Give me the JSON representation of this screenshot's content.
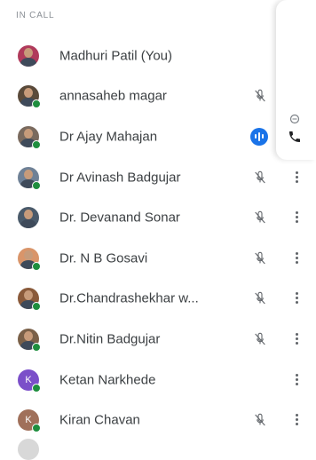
{
  "section": {
    "header": "IN CALL"
  },
  "participants": [
    {
      "name": "Madhuri Patil (You)",
      "avatar": {
        "type": "photo",
        "bg": "#b03a5b",
        "presence": false
      },
      "mic": "none",
      "more": false
    },
    {
      "name": "annasaheb magar",
      "avatar": {
        "type": "photo",
        "bg": "#5a4a3a",
        "presence": true
      },
      "mic": "muted",
      "more": false
    },
    {
      "name": "Dr Ajay Mahajan",
      "avatar": {
        "type": "photo",
        "bg": "#7a6a5e",
        "presence": true
      },
      "mic": "speaking",
      "more": false
    },
    {
      "name": "Dr Avinash Badgujar",
      "avatar": {
        "type": "photo",
        "bg": "#6f8196",
        "presence": true
      },
      "mic": "muted",
      "more": true
    },
    {
      "name": "Dr. Devanand Sonar",
      "avatar": {
        "type": "photo",
        "bg": "#4a5a6a",
        "presence": false
      },
      "mic": "muted",
      "more": true
    },
    {
      "name": "Dr. N B Gosavi",
      "avatar": {
        "type": "photo",
        "bg": "#d9956a",
        "presence": true
      },
      "mic": "muted",
      "more": true
    },
    {
      "name": "Dr.Chandrashekhar w...",
      "avatar": {
        "type": "photo",
        "bg": "#8a5a3a",
        "presence": true
      },
      "mic": "muted",
      "more": true
    },
    {
      "name": "Dr.Nitin Badgujar",
      "avatar": {
        "type": "photo",
        "bg": "#7a6048",
        "presence": true
      },
      "mic": "muted",
      "more": true
    },
    {
      "name": "Ketan Narkhede",
      "avatar": {
        "type": "letter",
        "letter": "K",
        "bg": "#7b4fc9",
        "presence": true
      },
      "mic": "none",
      "more": true
    },
    {
      "name": "Kiran Chavan",
      "avatar": {
        "type": "letter",
        "letter": "K",
        "bg": "#a0705a",
        "presence": true
      },
      "mic": "muted",
      "more": true
    }
  ],
  "side_panel": {
    "icons": [
      "ring-icon",
      "phone-icon"
    ]
  },
  "colors": {
    "accent": "#1a73e8",
    "presence": "#1e8e3e",
    "text": "#3c4043",
    "muted_icon": "#5f6368"
  }
}
